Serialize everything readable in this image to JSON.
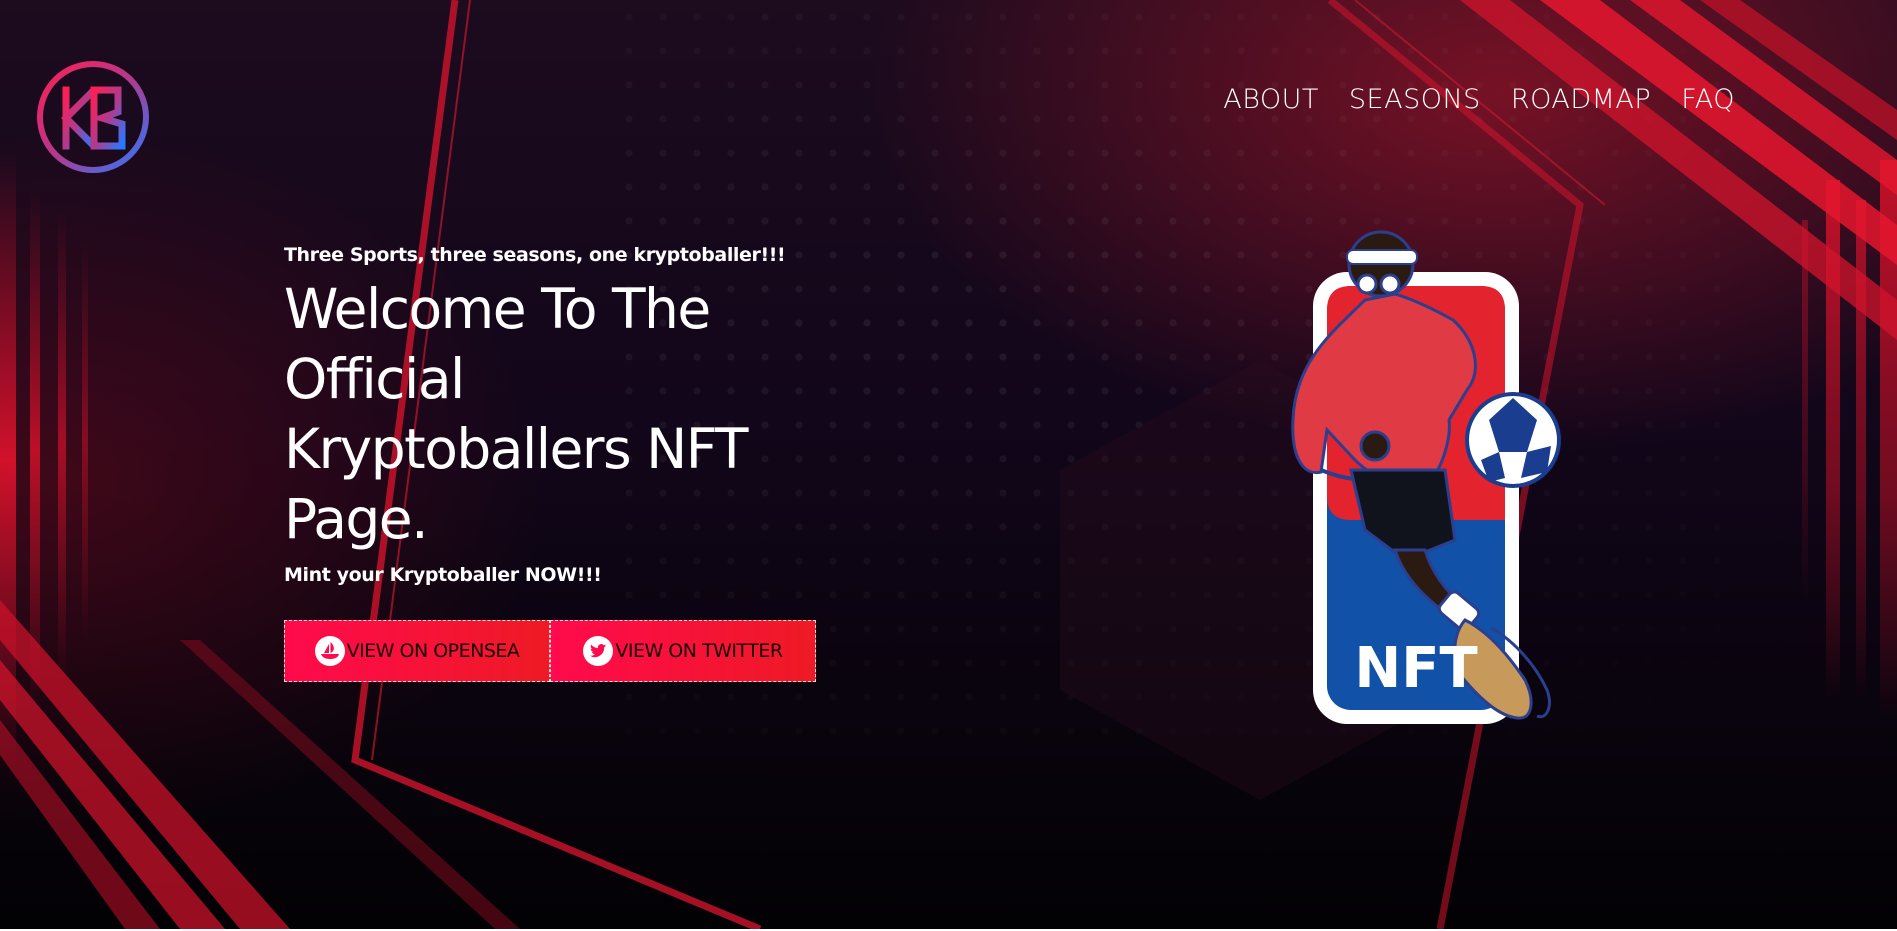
{
  "nav": {
    "items": [
      {
        "label": "ABOUT"
      },
      {
        "label": "SEASONS"
      },
      {
        "label": "ROADMAP"
      },
      {
        "label": "FAQ"
      }
    ]
  },
  "logo": {
    "icon": "kb-logo-icon"
  },
  "hero": {
    "tagline": "Three Sports, three seasons, one kryptoballer!!!",
    "headline": "Welcome To The Official Kryptoballers NFT Page.",
    "subline": "Mint your Kryptoballer NOW!!!",
    "buttons": [
      {
        "label": "VIEW ON OPENSEA",
        "icon": "opensea-icon"
      },
      {
        "label": "VIEW ON TWITTER",
        "icon": "twitter-icon"
      }
    ],
    "illustration_text": "NFT"
  },
  "colors": {
    "accent_red": "#ee1a24",
    "accent_pink": "#ff0a4d",
    "badge_blue": "#1251a8",
    "badge_red": "#e3232e"
  }
}
